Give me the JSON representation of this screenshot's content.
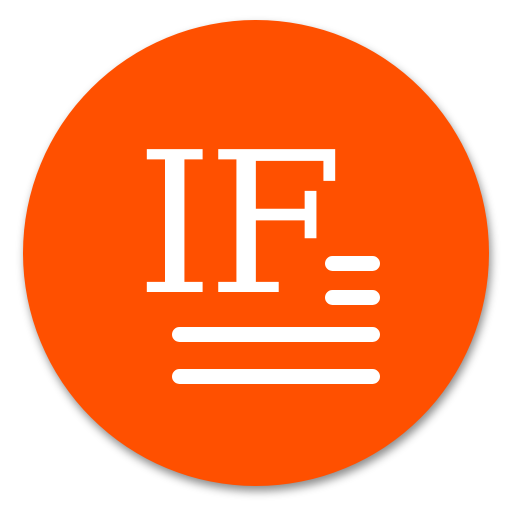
{
  "logo": {
    "text": "IF",
    "background_color": "#FF5000",
    "foreground_color": "#FFFFFF",
    "line_count": 4
  }
}
